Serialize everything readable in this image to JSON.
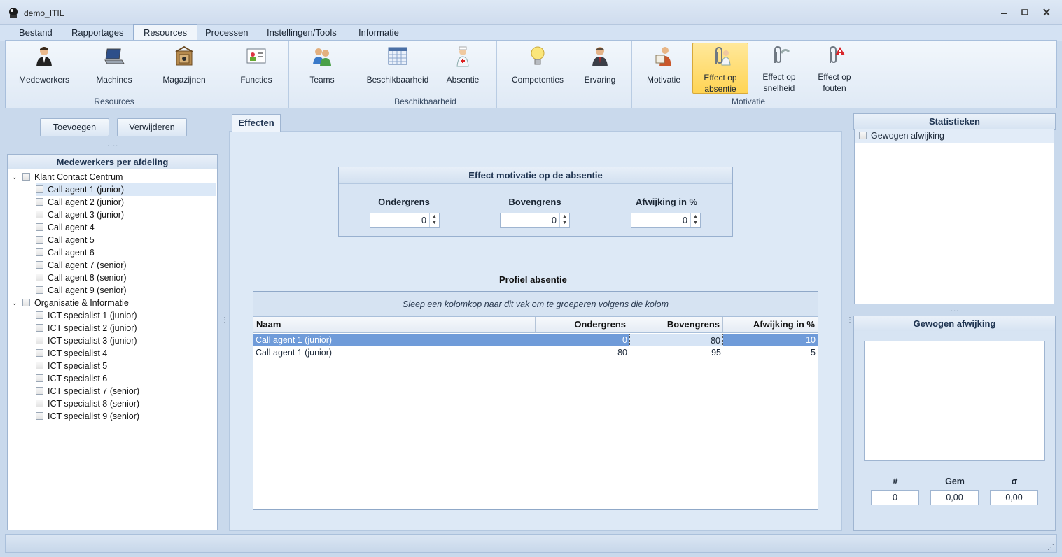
{
  "window": {
    "title": "demo_ITIL"
  },
  "menu": {
    "tabs": [
      "Bestand",
      "Rapportages",
      "Resources",
      "Processen",
      "Instellingen/Tools",
      "Informatie"
    ],
    "active": "Resources"
  },
  "ribbon": {
    "groups": [
      {
        "label": "Resources",
        "buttons": [
          {
            "label": "Medewerkers",
            "icon": "person-icon"
          },
          {
            "label": "Machines",
            "icon": "laptop-icon"
          },
          {
            "label": "Magazijnen",
            "icon": "warehouse-icon"
          }
        ]
      },
      {
        "label": "",
        "buttons": [
          {
            "label": "Functies",
            "icon": "id-card-icon"
          }
        ]
      },
      {
        "label": "",
        "buttons": [
          {
            "label": "Teams",
            "icon": "team-icon"
          }
        ]
      },
      {
        "label": "Beschikbaarheid",
        "buttons": [
          {
            "label": "Beschikbaarheid",
            "icon": "calendar-icon"
          },
          {
            "label": "Absentie",
            "icon": "nurse-icon"
          }
        ]
      },
      {
        "label": "",
        "buttons": [
          {
            "label": "Competenties",
            "icon": "lightbulb-icon"
          },
          {
            "label": "Ervaring",
            "icon": "manager-icon"
          }
        ]
      },
      {
        "label": "Motivatie",
        "buttons": [
          {
            "label": "Motivatie",
            "icon": "reading-person-icon"
          },
          {
            "label_1": "Effect op",
            "label_2": "absentie",
            "icon": "paperclip-nurse-icon",
            "active": true
          },
          {
            "label_1": "Effect op",
            "label_2": "snelheid",
            "icon": "paperclip-speed-icon"
          },
          {
            "label_1": "Effect op",
            "label_2": "fouten",
            "icon": "paperclip-warning-icon"
          }
        ]
      }
    ]
  },
  "left_panel": {
    "add_button": "Toevoegen",
    "remove_button": "Verwijderen",
    "splitter": "....",
    "header": "Medewerkers per afdeling",
    "departments": [
      {
        "name": "Klant Contact Centrum",
        "employees": [
          "Call agent 1 (junior)",
          "Call agent 2 (junior)",
          "Call agent 3 (junior)",
          "Call agent 4",
          "Call agent 5",
          "Call agent 6",
          "Call agent 7 (senior)",
          "Call agent 8 (senior)",
          "Call agent 9 (senior)"
        ]
      },
      {
        "name": "Organisatie & Informatie",
        "employees": [
          "ICT specialist 1 (junior)",
          "ICT specialist 2 (junior)",
          "ICT specialist 3 (junior)",
          "ICT specialist 4",
          "ICT specialist 5",
          "ICT specialist 6",
          "ICT specialist 7 (senior)",
          "ICT specialist 8 (senior)",
          "ICT specialist 9 (senior)"
        ]
      }
    ]
  },
  "center": {
    "tab": "Effecten",
    "effect_box": {
      "title": "Effect motivatie op de absentie",
      "lower_label": "Ondergrens",
      "lower_value": "0",
      "upper_label": "Bovengrens",
      "upper_value": "0",
      "dev_label": "Afwijking in %",
      "dev_value": "0"
    },
    "profile_title": "Profiel absentie",
    "grid": {
      "group_hint": "Sleep een kolomkop naar dit vak om te groeperen volgens die kolom",
      "columns": [
        "Naam",
        "Ondergrens",
        "Bovengrens",
        "Afwijking in %"
      ],
      "rows": [
        [
          "Call agent 1 (junior)",
          "0",
          "80",
          "10"
        ],
        [
          "Call agent 1 (junior)",
          "80",
          "95",
          "5"
        ]
      ]
    }
  },
  "right_panel": {
    "stats_header": "Statistieken",
    "stats_items": [
      "Gewogen afwijking"
    ],
    "splitter": "....",
    "weighted_header": "Gewogen afwijking",
    "count_label": "#",
    "count_value": "0",
    "mean_label": "Gem",
    "mean_value": "0,00",
    "sigma_label": "σ",
    "sigma_value": "0,00"
  }
}
